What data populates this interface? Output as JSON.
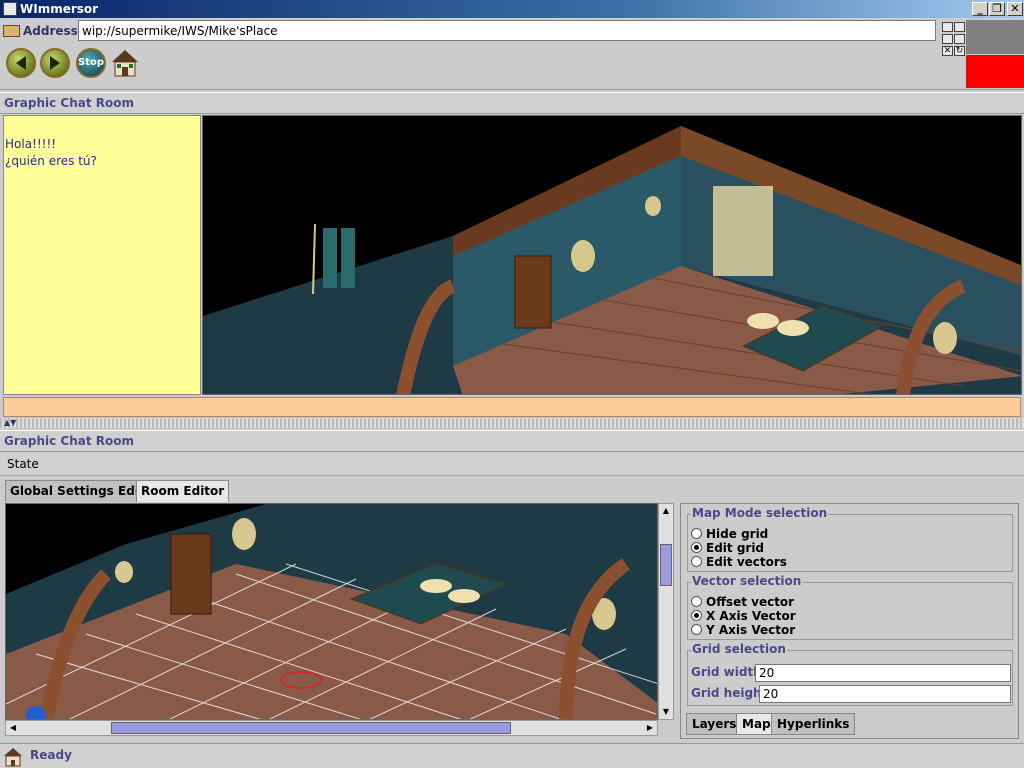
{
  "window": {
    "title": "WImmersor"
  },
  "address": {
    "label": "Address:",
    "value": "wip://supermike/IWS/Mike'sPlace"
  },
  "nav": {
    "stop_label": "Stop"
  },
  "sections": {
    "upper_title": "Graphic Chat Room",
    "lower_title": "Graphic Chat Room"
  },
  "chat": {
    "lines": [
      "Hola!!!!!",
      "¿quién eres tú?"
    ]
  },
  "state": {
    "label": "State"
  },
  "editor_tabs": [
    "Global Settings Editor",
    "Room Editor"
  ],
  "map_mode": {
    "legend": "Map Mode selection",
    "options": [
      "Hide grid",
      "Edit grid",
      "Edit vectors"
    ],
    "selected": "Edit grid"
  },
  "vector": {
    "legend": "Vector selection",
    "options": [
      "Offset vector",
      "X Axis Vector",
      "Y Axis Vector"
    ],
    "selected": "X Axis Vector"
  },
  "grid": {
    "legend": "Grid selection",
    "width_label": "Grid width:",
    "width_value": "20",
    "height_label": "Grid height:",
    "height_value": "20"
  },
  "bottom_tabs": [
    "Layers",
    "Map",
    "Hyperlinks"
  ],
  "status": {
    "text": "Ready"
  },
  "colors": {
    "chat_bg": "#ffff99",
    "chat_input_bg": "#ffcc99",
    "swatch_top": "#808080",
    "swatch_bottom": "#ff0000",
    "accent": "#4a4a8a"
  },
  "icons": [
    "back-arrow-icon",
    "forward-arrow-icon",
    "stop-icon",
    "home-icon",
    "folder-icon"
  ]
}
